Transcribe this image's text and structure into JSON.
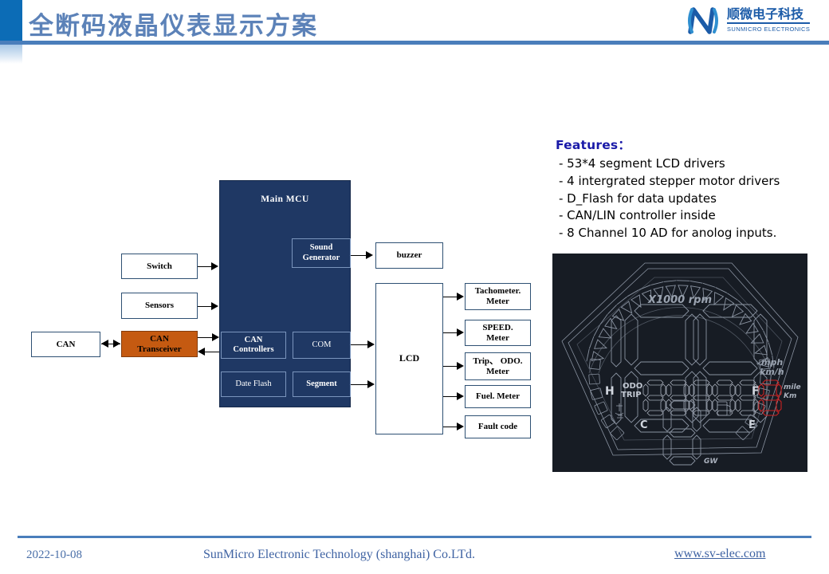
{
  "header": {
    "title": "全断码液晶仪表显示方案",
    "logo": {
      "cn_name": "顺微电子科技",
      "en_name": "SUNMICRO ELECTRONICS",
      "brand_color": "#1b5ba8"
    },
    "accent_color": "#0c6cb6",
    "rule_color": "#4a7ebb"
  },
  "diagram": {
    "inputs": [
      {
        "label": "Switch"
      },
      {
        "label": "Sensors"
      },
      {
        "label": "CAN"
      },
      {
        "label": "CAN\nTransceiver",
        "line1": "CAN",
        "line2": "Transceiver",
        "color": "#c55a11"
      }
    ],
    "mcu": {
      "title": "Main  MCU",
      "color": "#1f3864",
      "blocks": [
        {
          "line1": "Sound",
          "line2": "Generator"
        },
        {
          "line1": "CAN",
          "line2": "Controllers"
        },
        {
          "line1": "COM",
          "line2": ""
        },
        {
          "line1": "Date Flash",
          "line2": ""
        },
        {
          "line1": "Segment",
          "line2": ""
        }
      ]
    },
    "outputs": [
      {
        "label": "buzzer"
      },
      {
        "label": "LCD"
      }
    ],
    "meters": [
      {
        "line1": "Tachometer.",
        "line2": "Meter"
      },
      {
        "line1": "SPEED.",
        "line2": "Meter"
      },
      {
        "line1": "Trip、 ODO.",
        "line2": "Meter"
      },
      {
        "line1": "Fuel. Meter",
        "line2": ""
      },
      {
        "line1": "Fault code",
        "line2": ""
      }
    ]
  },
  "features": {
    "title": "Features：",
    "title_color": "#1a1aa8",
    "items": [
      "- 53*4 segment LCD drivers",
      "- 4 intergrated stepper motor drivers",
      "- D_Flash for data updates",
      "- CAN/LIN controller inside",
      "- 8 Channel 10 AD for anolog inputs."
    ]
  },
  "lcd_preview": {
    "background": "#171c24",
    "outline_color": "#8f98a6",
    "highlight_color": "#cc2222",
    "labels": {
      "rpm": "X1000 rpm",
      "mph": "mph",
      "kmh": "km/h",
      "odo": "ODO",
      "trip": "TRIP",
      "mile": "mile",
      "km": "Km",
      "temp_hot": "H",
      "temp_cold": "C",
      "fuel_empty": "E",
      "fuel_full": "F",
      "gear": "GW"
    }
  },
  "footer": {
    "date": "2022-10-08",
    "company": "SunMicro Electronic Technology (shanghai) Co.LTd.",
    "url": "www.sv-elec.com",
    "rule_color": "#4a7ebb"
  }
}
